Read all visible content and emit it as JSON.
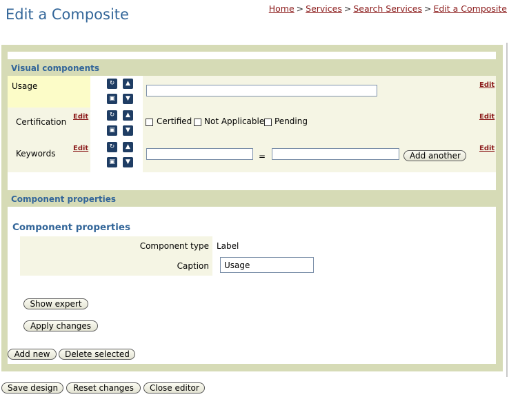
{
  "page": {
    "title": "Edit a Composite"
  },
  "breadcrumb": {
    "items": [
      "Home",
      "Services",
      "Search Services",
      "Edit a Composite"
    ],
    "separator": ">"
  },
  "visual": {
    "title": "Visual components",
    "edit_label": "Edit",
    "rows": {
      "usage": {
        "label": "Usage",
        "value": ""
      },
      "certification": {
        "label": "Certification",
        "options": [
          "Certified",
          "Not Applicable",
          "Pending"
        ]
      },
      "keywords": {
        "label": "Keywords",
        "key": "",
        "equals": "=",
        "value": "",
        "add_label": "Add another"
      }
    }
  },
  "component_properties": {
    "band_title": "Component properties",
    "heading": "Component properties",
    "type_label": "Component type",
    "type_value": "Label",
    "caption_label": "Caption",
    "caption_value": "Usage",
    "show_expert": "Show expert",
    "apply": "Apply changes"
  },
  "frame_buttons": {
    "add_new": "Add new",
    "delete_selected": "Delete selected"
  },
  "footer_buttons": {
    "save": "Save design",
    "reset": "Reset changes",
    "close": "Close editor"
  },
  "icons": {
    "rotate": "rotate-icon",
    "lock": "lock-icon",
    "up": "arrow-up-icon",
    "down": "arrow-down-icon"
  },
  "colors": {
    "accent": "#336699",
    "frame": "#d6dbb6",
    "link": "#8b1a1a",
    "usage_highlight": "#fcfcc8",
    "icon_bg": "#1f3d64"
  }
}
